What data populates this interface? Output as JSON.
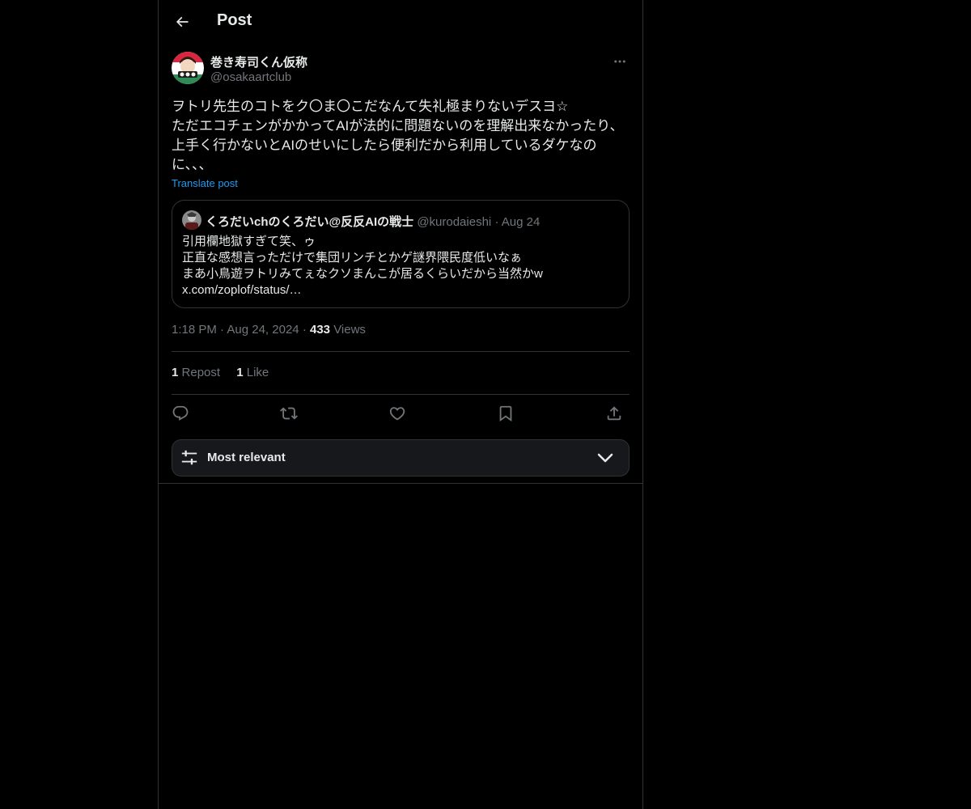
{
  "header": {
    "title": "Post",
    "back_icon": "arrow-left-icon"
  },
  "post": {
    "author_name": "巻き寿司くん仮称",
    "author_handle": "@osakaartclub",
    "text_lines": [
      "ヲトリ先生のコトをク〇ま〇こだなんて失礼極まりないデスヨ☆",
      "ただエコチェンがかかってAIが法的に問題ないのを理解出来なかったり、",
      "上手く行かないとAIのせいにしたら便利だから利用しているダケなの",
      "に、、、"
    ],
    "translate_label": "Translate post",
    "quote": {
      "author_name": "くろだいchのくろだい@反反AIの戦士",
      "author_handle": "@kurodaieshi",
      "separator": "·",
      "date": "Aug 24",
      "lines": [
        "引用欄地獄すぎて笑、ゥ",
        "正直な感想言っただけで集団リンチとかゲ謎界隈民度低いなぁ",
        "まあ小鳥遊ヲトリみてぇなクソまんこが居るくらいだから当然かw",
        "x.com/zoplof/status/…"
      ]
    },
    "time": "1:18 PM",
    "separator": "·",
    "date": "Aug 24, 2024",
    "views_count": "433",
    "views_label": "Views",
    "reposts_count": "1",
    "reposts_label": "Repost",
    "likes_count": "1",
    "likes_label": "Like"
  },
  "actions": [
    "reply-icon",
    "repost-icon",
    "like-icon",
    "bookmark-icon",
    "share-icon"
  ],
  "sort": {
    "label": "Most relevant",
    "icon": "sliders-icon",
    "chevron": "chevron-down-icon"
  },
  "colors": {
    "background": "#000000",
    "text": "#e7e9ea",
    "muted": "#71767b",
    "link": "#1d9bf0",
    "border": "#2f3336"
  }
}
